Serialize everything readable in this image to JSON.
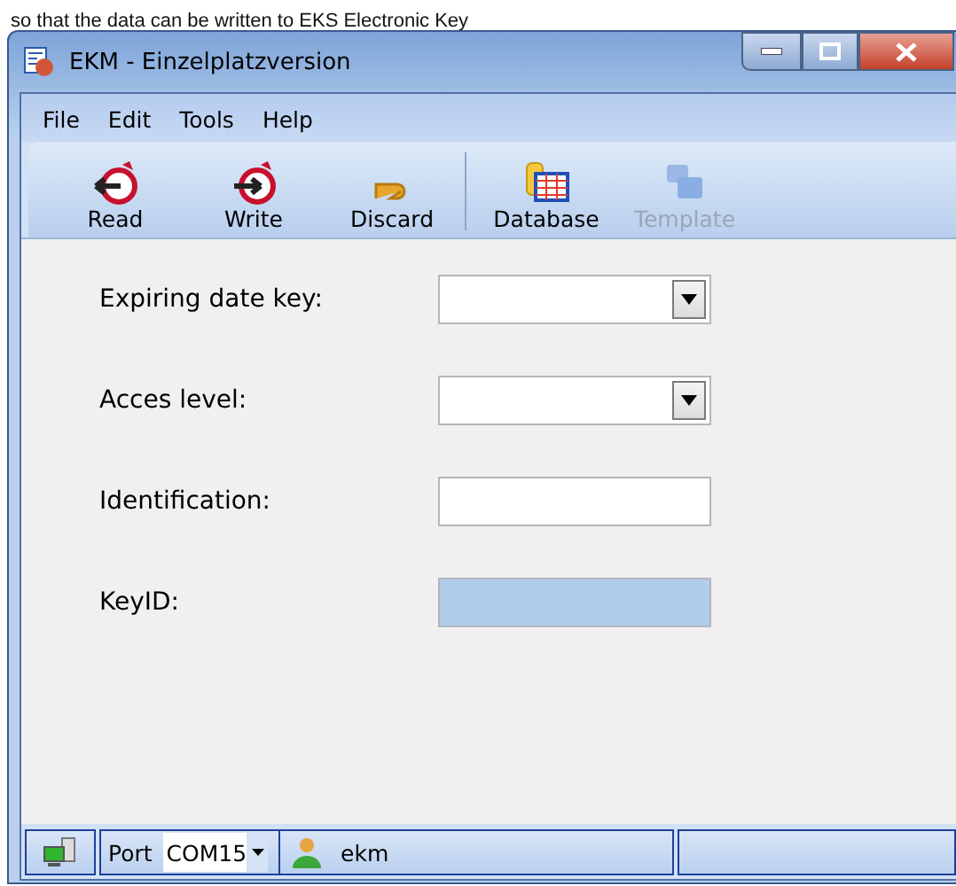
{
  "backdrop_text": "so that the data can be written to EKS Electronic Key",
  "window": {
    "title": "EKM - Einzelplatzversion"
  },
  "menu": [
    {
      "label": "File"
    },
    {
      "label": "Edit"
    },
    {
      "label": "Tools"
    },
    {
      "label": "Help"
    }
  ],
  "toolbar": [
    {
      "label": "Read",
      "kind": "read",
      "disabled": false
    },
    {
      "label": "Write",
      "kind": "write",
      "disabled": false
    },
    {
      "label": "Discard",
      "kind": "discard",
      "disabled": false
    },
    {
      "kind": "separator"
    },
    {
      "label": "Database",
      "kind": "database",
      "disabled": false
    },
    {
      "label": "Template",
      "kind": "template",
      "disabled": true
    }
  ],
  "form": [
    {
      "label": "Expiring date key:",
      "kind": "dropdown",
      "readonly": false
    },
    {
      "label": "Acces level:",
      "kind": "dropdown",
      "readonly": false
    },
    {
      "label": "Identification:",
      "kind": "text",
      "readonly": false
    },
    {
      "label": "KeyID:",
      "kind": "text",
      "readonly": true
    }
  ],
  "status_bar": {
    "port_label": "Port",
    "port_value": "COM15",
    "user": "ekm"
  }
}
